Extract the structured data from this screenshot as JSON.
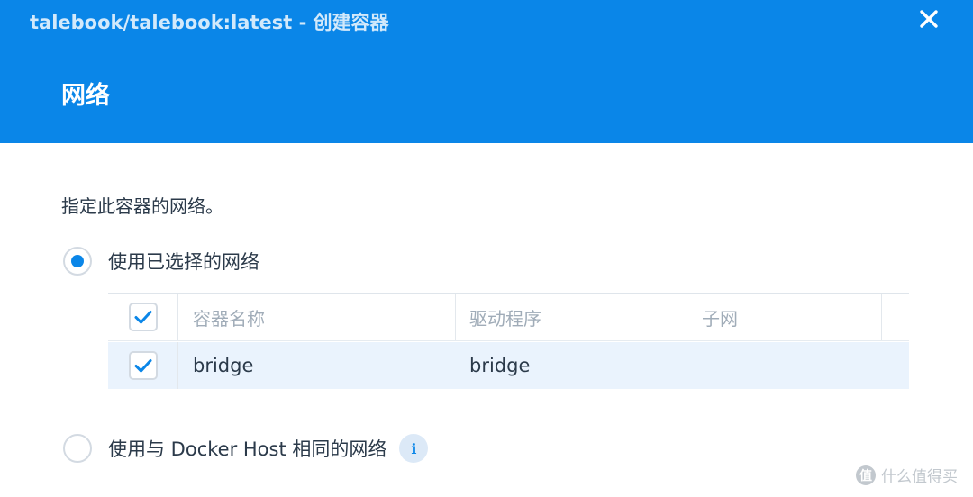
{
  "window": {
    "title": "talebook/talebook:latest - 创建容器",
    "close_icon": "close-icon"
  },
  "step": {
    "title": "网络"
  },
  "content": {
    "description": "指定此容器的网络。",
    "option_selected_network": {
      "label": "使用已选择的网络",
      "selected": true
    },
    "option_host_network": {
      "label": "使用与 Docker Host 相同的网络",
      "selected": false,
      "info_icon": "info-icon",
      "info_glyph": "i"
    }
  },
  "network_table": {
    "select_all_checked": true,
    "columns": [
      "容器名称",
      "驱动程序",
      "子网"
    ],
    "rows": [
      {
        "checked": true,
        "name": "bridge",
        "driver": "bridge",
        "subnet": ""
      }
    ]
  },
  "watermark": {
    "glyph": "值",
    "text": "什么值得买"
  },
  "colors": {
    "header_bg": "#0a86e8",
    "accent": "#0a86e8",
    "selected_row_bg": "#eaf3fd"
  }
}
